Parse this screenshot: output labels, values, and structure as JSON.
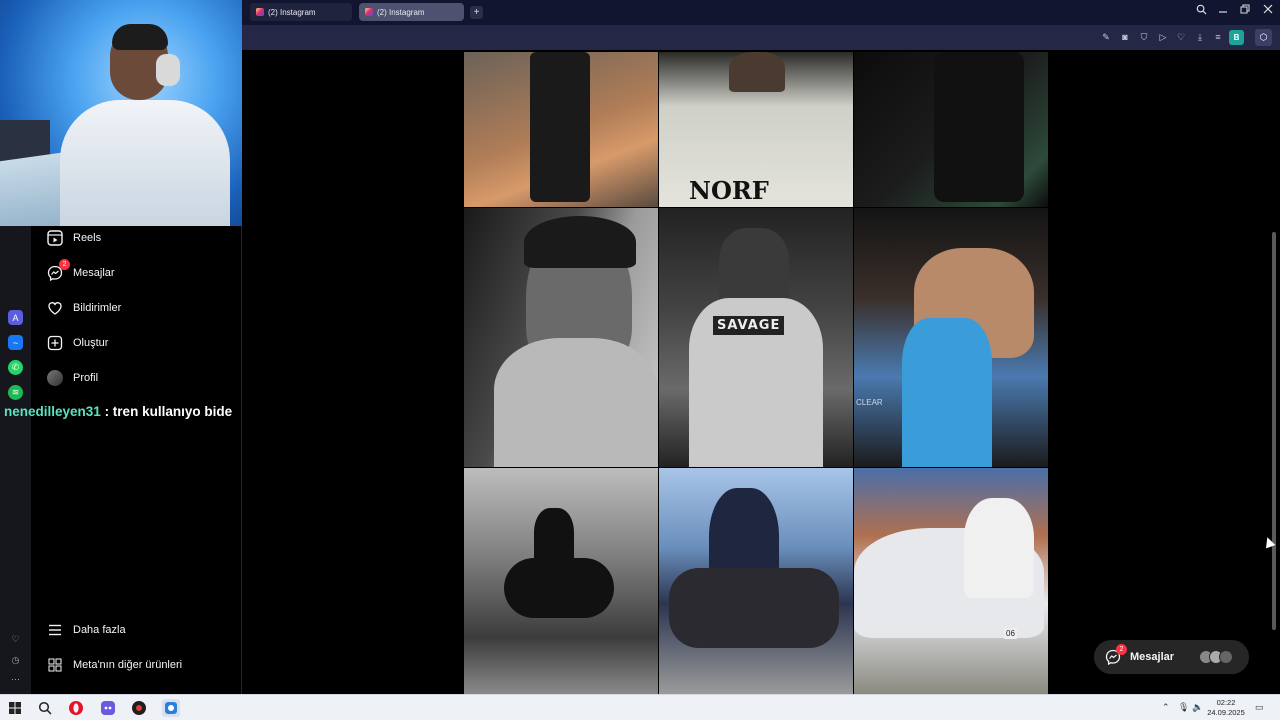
{
  "browser": {
    "tabs": [
      {
        "label": "(2) Instagram"
      },
      {
        "label": "(2) Instagram"
      }
    ],
    "new_tab": "+",
    "profile_badge": "B"
  },
  "sidebar": {
    "items": [
      {
        "label": "Reels",
        "icon": "reels-icon"
      },
      {
        "label": "Mesajlar",
        "icon": "messenger-icon",
        "badge": "2"
      },
      {
        "label": "Bildirimler",
        "icon": "heart-icon"
      },
      {
        "label": "Oluştur",
        "icon": "plus-square-icon"
      },
      {
        "label": "Profil",
        "icon": "avatar"
      }
    ],
    "bottom_items": [
      {
        "label": "Daha fazla",
        "icon": "hamburger-icon"
      },
      {
        "label": "Meta'nın diğer ürünleri",
        "icon": "grid-icon"
      }
    ]
  },
  "stream_chat": {
    "username": "nenedilleyen31",
    "message": ": tren kullanıyo bide"
  },
  "posts": {
    "p2_text": "NORF",
    "p5_text": "SAVAGE",
    "p6_text": "CLEAR",
    "p9_plate": "06"
  },
  "messages_button": {
    "label": "Mesajlar",
    "badge": "2"
  },
  "taskbar": {
    "time": "02:22",
    "date": "24.09.2025"
  },
  "colors": {
    "accent_chat_user": "#5be3c0",
    "badge_red": "#ff3040",
    "tab_bar": "#121530",
    "toolbar": "#242846"
  }
}
